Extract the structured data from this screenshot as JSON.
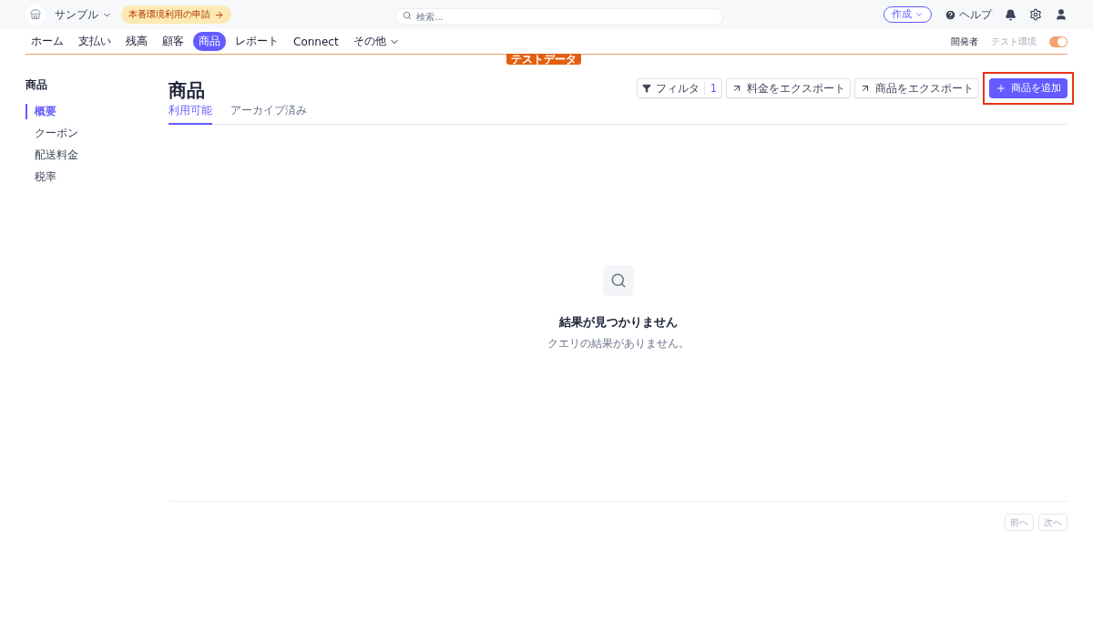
{
  "topbar": {
    "account": "サンプル",
    "activation": "本番環境利用の申請",
    "search": {
      "placeholder": "検索..."
    },
    "create": "作成",
    "help": "ヘルプ"
  },
  "nav": {
    "items": [
      {
        "label": "ホーム",
        "selected": false
      },
      {
        "label": "支払い",
        "selected": false
      },
      {
        "label": "残高",
        "selected": false
      },
      {
        "label": "顧客",
        "selected": false
      },
      {
        "label": "商品",
        "selected": true
      },
      {
        "label": "レポート",
        "selected": false
      },
      {
        "label": "Connect",
        "selected": false
      },
      {
        "label": "その他",
        "selected": false,
        "dropdown": true
      }
    ],
    "developer": "開発者",
    "test_mode": {
      "label": "テスト環境",
      "on": true
    },
    "test_badge": "テストデータ"
  },
  "sidebar": {
    "title": "商品",
    "items": [
      {
        "label": "概要",
        "selected": true
      },
      {
        "label": "クーポン",
        "selected": false
      },
      {
        "label": "配送料金",
        "selected": false
      },
      {
        "label": "税率",
        "selected": false
      }
    ]
  },
  "main": {
    "title": "商品",
    "actions": [
      {
        "kind": "filter",
        "label": "フィルタ",
        "count": "1"
      },
      {
        "kind": "export",
        "label": "料金をエクスポート"
      },
      {
        "kind": "export",
        "label": "商品をエクスポート"
      },
      {
        "kind": "primary",
        "label": "商品を追加",
        "highlighted": true
      }
    ],
    "tabs": [
      {
        "label": "利用可能",
        "selected": true
      },
      {
        "label": "アーカイブ済み",
        "selected": false
      }
    ],
    "empty": {
      "title": "結果が見つかりません",
      "message": "クエリの結果がありません。"
    },
    "pagination": [
      {
        "label": "前へ",
        "disabled": true
      },
      {
        "label": "次へ",
        "disabled": true
      }
    ]
  }
}
